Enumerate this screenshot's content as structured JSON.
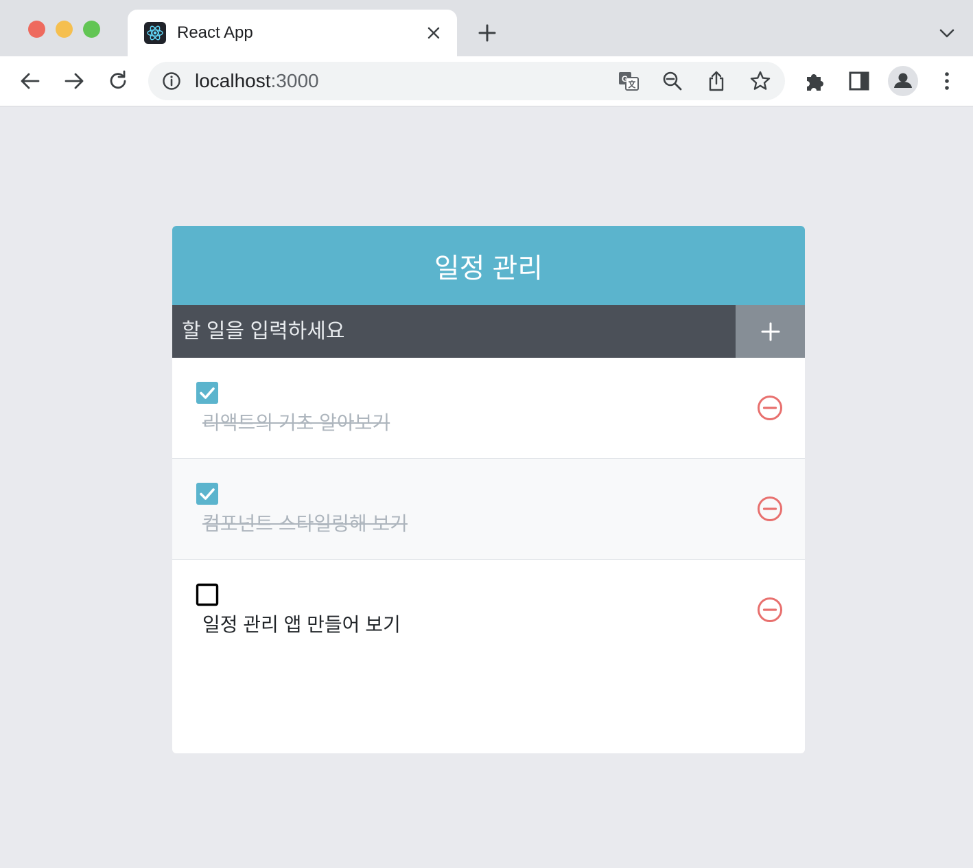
{
  "browser": {
    "tab_title": "React App",
    "url_host": "localhost",
    "url_port": ":3000"
  },
  "colors": {
    "header": "#5bb4cd",
    "insert_bar": "#495057",
    "add_button": "#868e96",
    "remove_icon": "#e8706e",
    "checked_box": "#5bb4cd"
  },
  "app": {
    "title": "일정 관리",
    "input_placeholder": "할 일을 입력하세요",
    "todos": [
      {
        "text": "리액트의 기초 알아보기",
        "checked": true
      },
      {
        "text": "컴포넌트 스타일링해 보기",
        "checked": true
      },
      {
        "text": "일정 관리 앱 만들어 보기",
        "checked": false
      }
    ]
  }
}
